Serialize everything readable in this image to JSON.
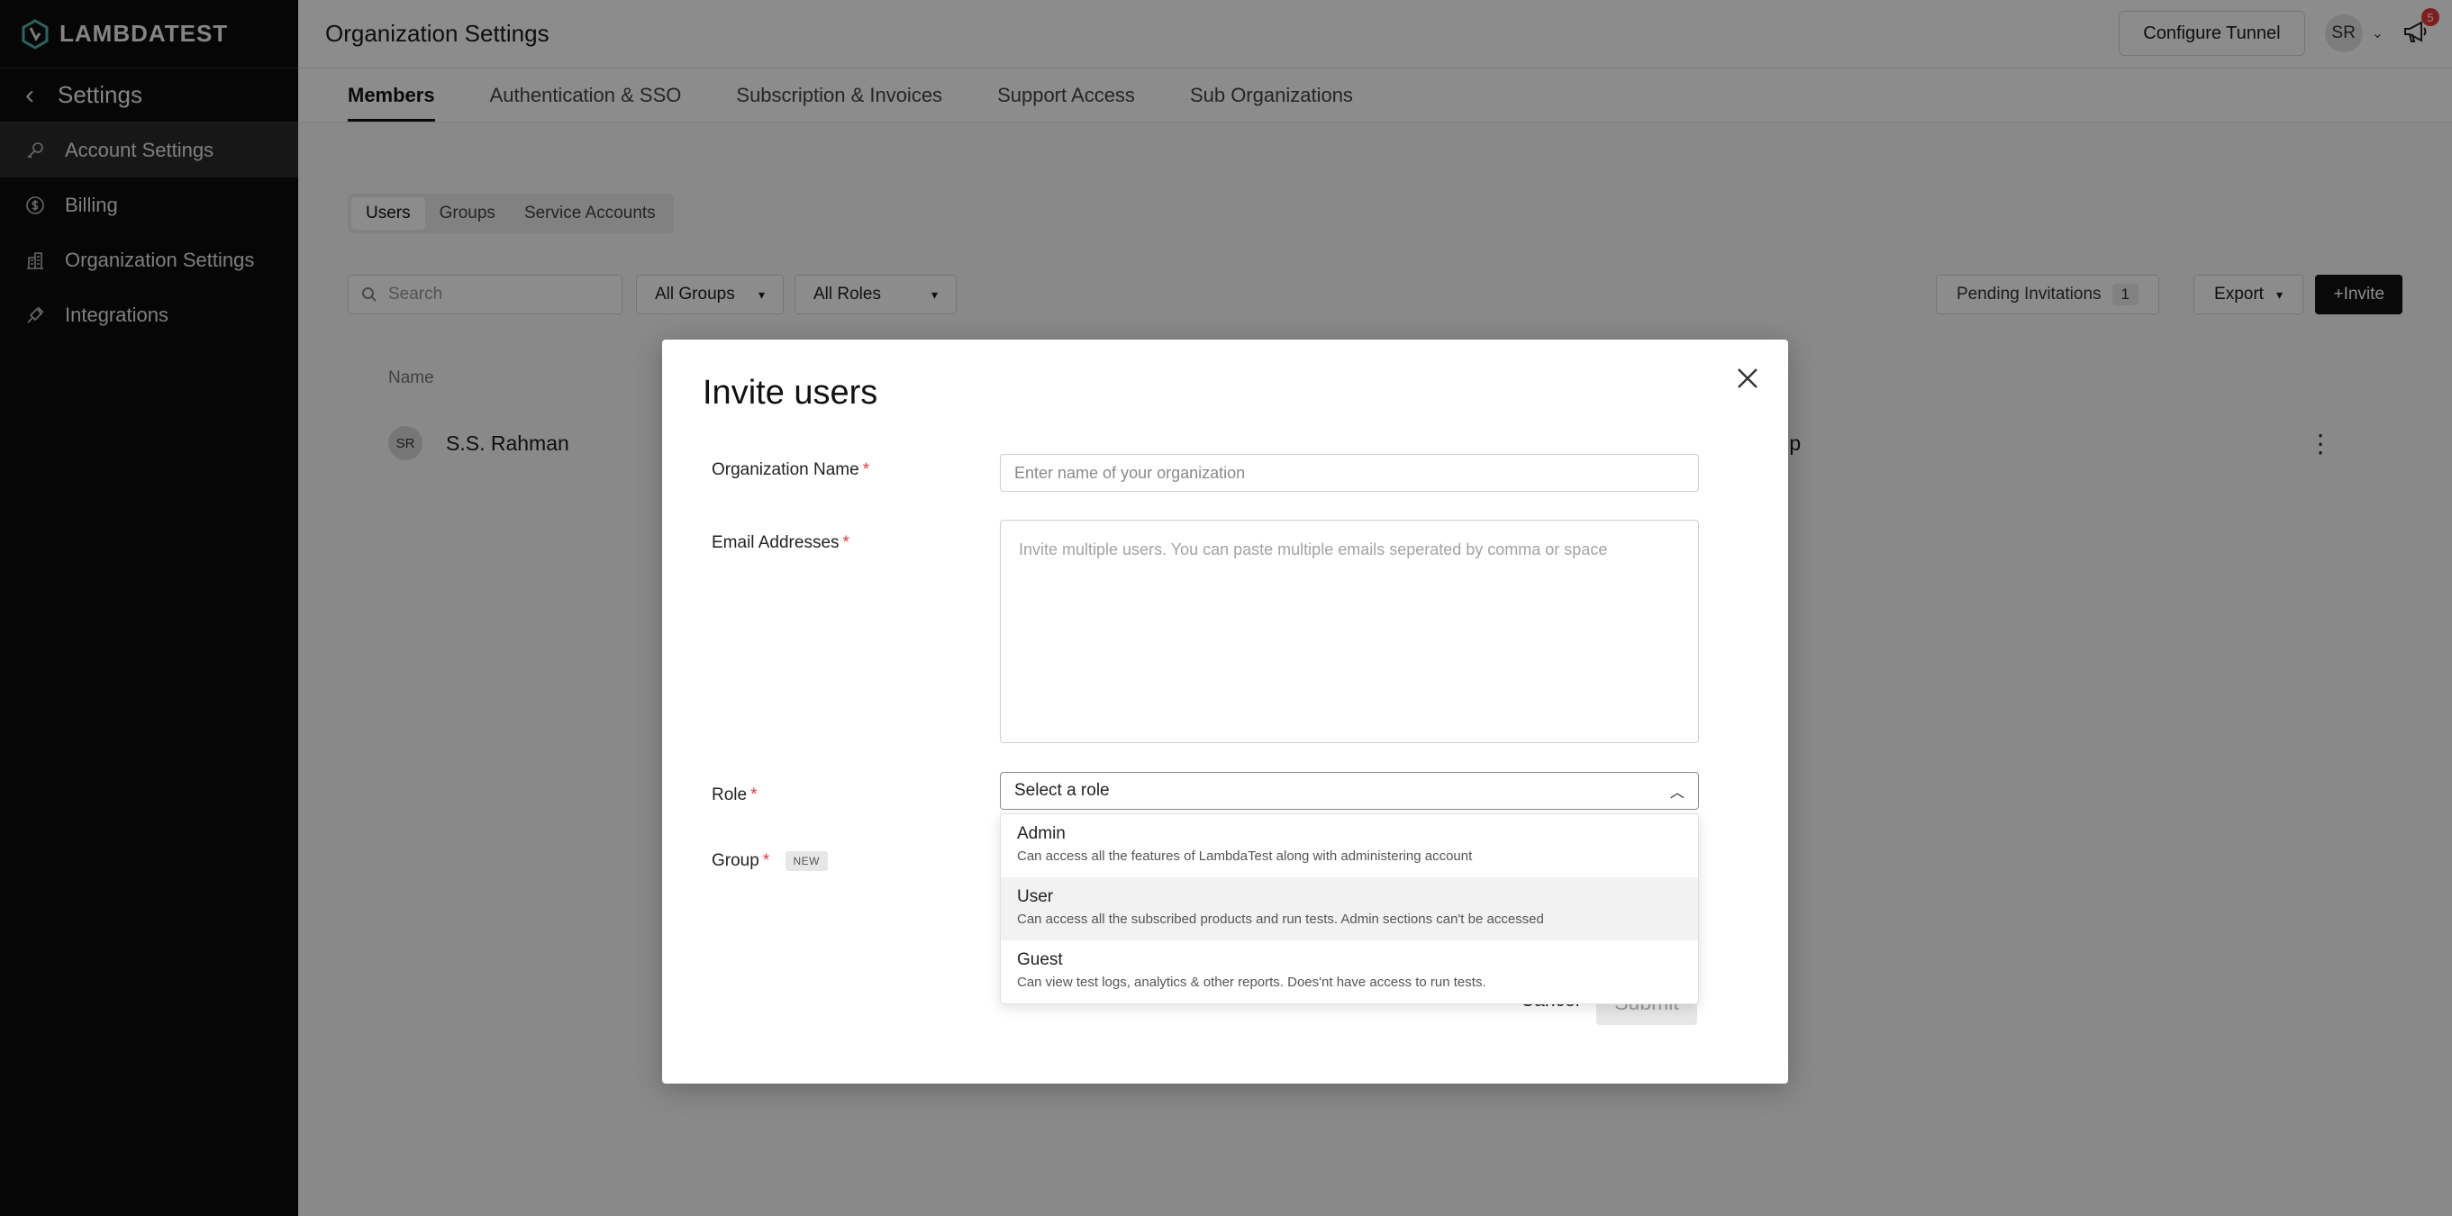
{
  "app": {
    "brand": "LAMBDATEST"
  },
  "sidebar": {
    "back_label": "Settings",
    "items": [
      {
        "label": "Account Settings",
        "icon": "key-icon",
        "active": true
      },
      {
        "label": "Billing",
        "icon": "dollar-icon",
        "active": false
      },
      {
        "label": "Organization Settings",
        "icon": "building-icon",
        "active": false
      },
      {
        "label": "Integrations",
        "icon": "plug-icon",
        "active": false
      }
    ]
  },
  "header": {
    "title": "Organization Settings",
    "configure_tunnel": "Configure Tunnel",
    "avatar_initials": "SR",
    "notification_count": "5"
  },
  "tabs": [
    "Members",
    "Authentication & SSO",
    "Subscription & Invoices",
    "Support Access",
    "Sub Organizations"
  ],
  "subtabs": [
    "Users",
    "Groups",
    "Service Accounts"
  ],
  "filters": {
    "search_placeholder": "Search",
    "groups": "All Groups",
    "roles": "All Roles",
    "pending_label": "Pending Invitations",
    "pending_count": "1",
    "export": "Export",
    "invite": "+Invite"
  },
  "table": {
    "name_header": "Name",
    "row": {
      "initials": "SR",
      "name": "S.S. Rahman",
      "group": "ılt Group"
    }
  },
  "modal": {
    "title": "Invite users",
    "org_label": "Organization Name",
    "org_placeholder": "Enter name of your organization",
    "email_label": "Email Addresses",
    "email_placeholder": "Invite multiple users. You can paste multiple emails seperated by comma or space",
    "role_label": "Role",
    "role_placeholder": "Select a role",
    "group_label": "Group",
    "group_badge": "NEW",
    "required_mark": "*",
    "roles": [
      {
        "title": "Admin",
        "desc": "Can access all the features of LambdaTest along with administering account"
      },
      {
        "title": "User",
        "desc": "Can access all the subscribed products and run tests. Admin sections can't be accessed"
      },
      {
        "title": "Guest",
        "desc": "Can view test logs, analytics & other reports. Does'nt have access to run tests."
      }
    ],
    "cancel": "Cancel",
    "submit": "Submit"
  }
}
